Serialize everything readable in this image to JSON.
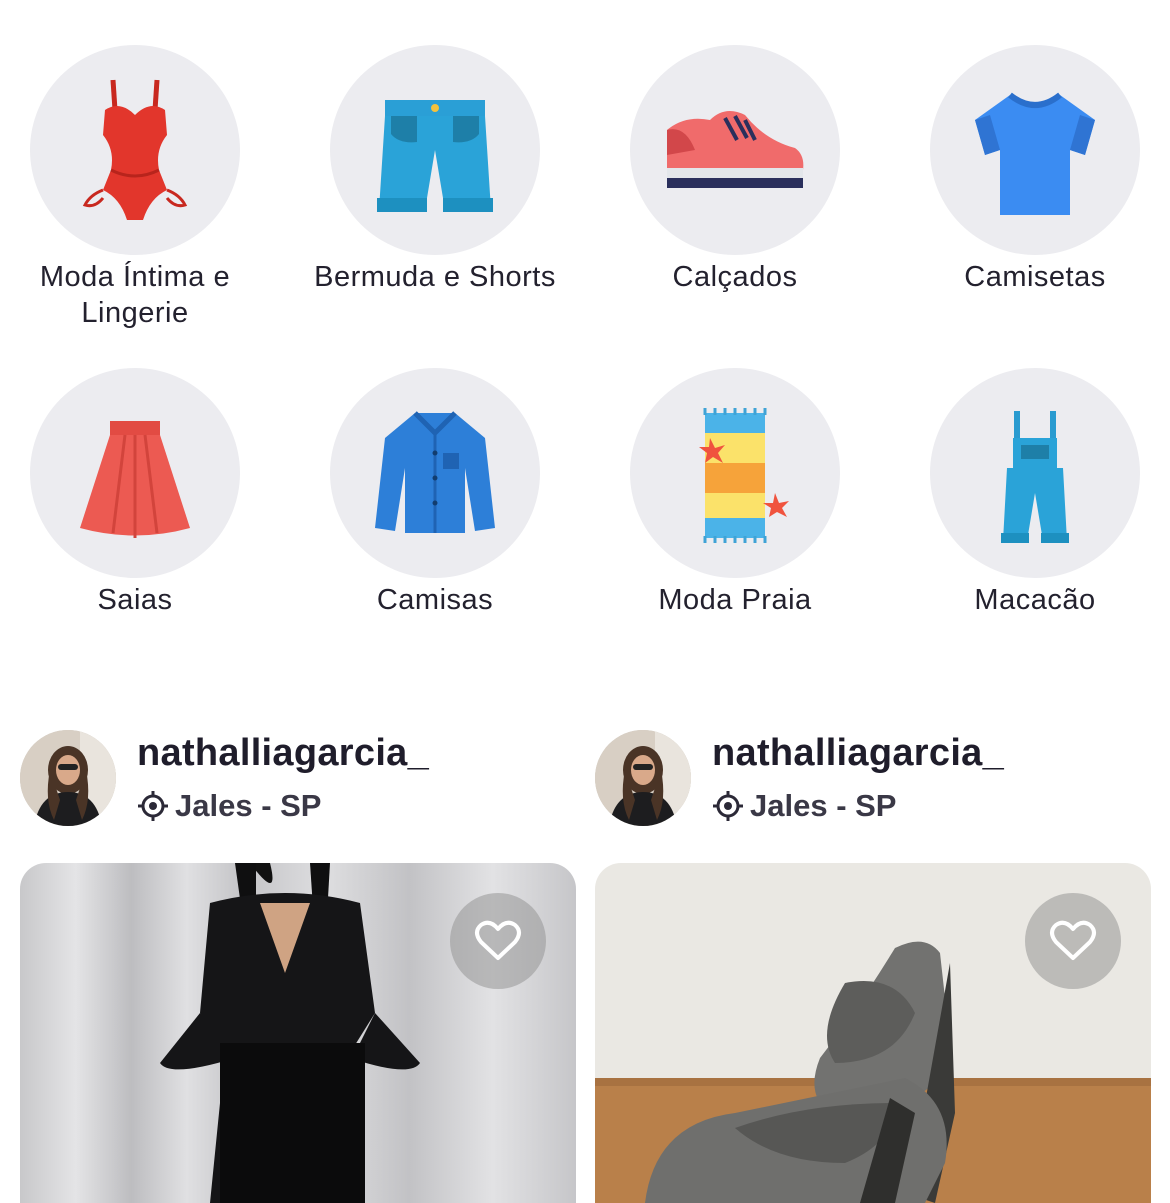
{
  "categories": [
    {
      "label": "Moda Íntima e Lingerie",
      "icon": "lingerie-icon"
    },
    {
      "label": "Bermuda e Shorts",
      "icon": "shorts-icon"
    },
    {
      "label": "Calçados",
      "icon": "sneaker-icon"
    },
    {
      "label": "Camisetas",
      "icon": "tshirt-icon"
    },
    {
      "label": "Saias",
      "icon": "skirt-icon"
    },
    {
      "label": "Camisas",
      "icon": "shirt-icon"
    },
    {
      "label": "Moda Praia",
      "icon": "beach-towel-icon"
    },
    {
      "label": "Macacão",
      "icon": "overalls-icon"
    }
  ],
  "products": [
    {
      "username": "nathalliagarcia_",
      "location": "Jales - SP",
      "photo": "black-dress-photo"
    },
    {
      "username": "nathalliagarcia_",
      "location": "Jales - SP",
      "photo": "grey-shoes-photo"
    }
  ],
  "colors": {
    "circle_bg": "#ececf0",
    "text": "#1f1d2b"
  }
}
